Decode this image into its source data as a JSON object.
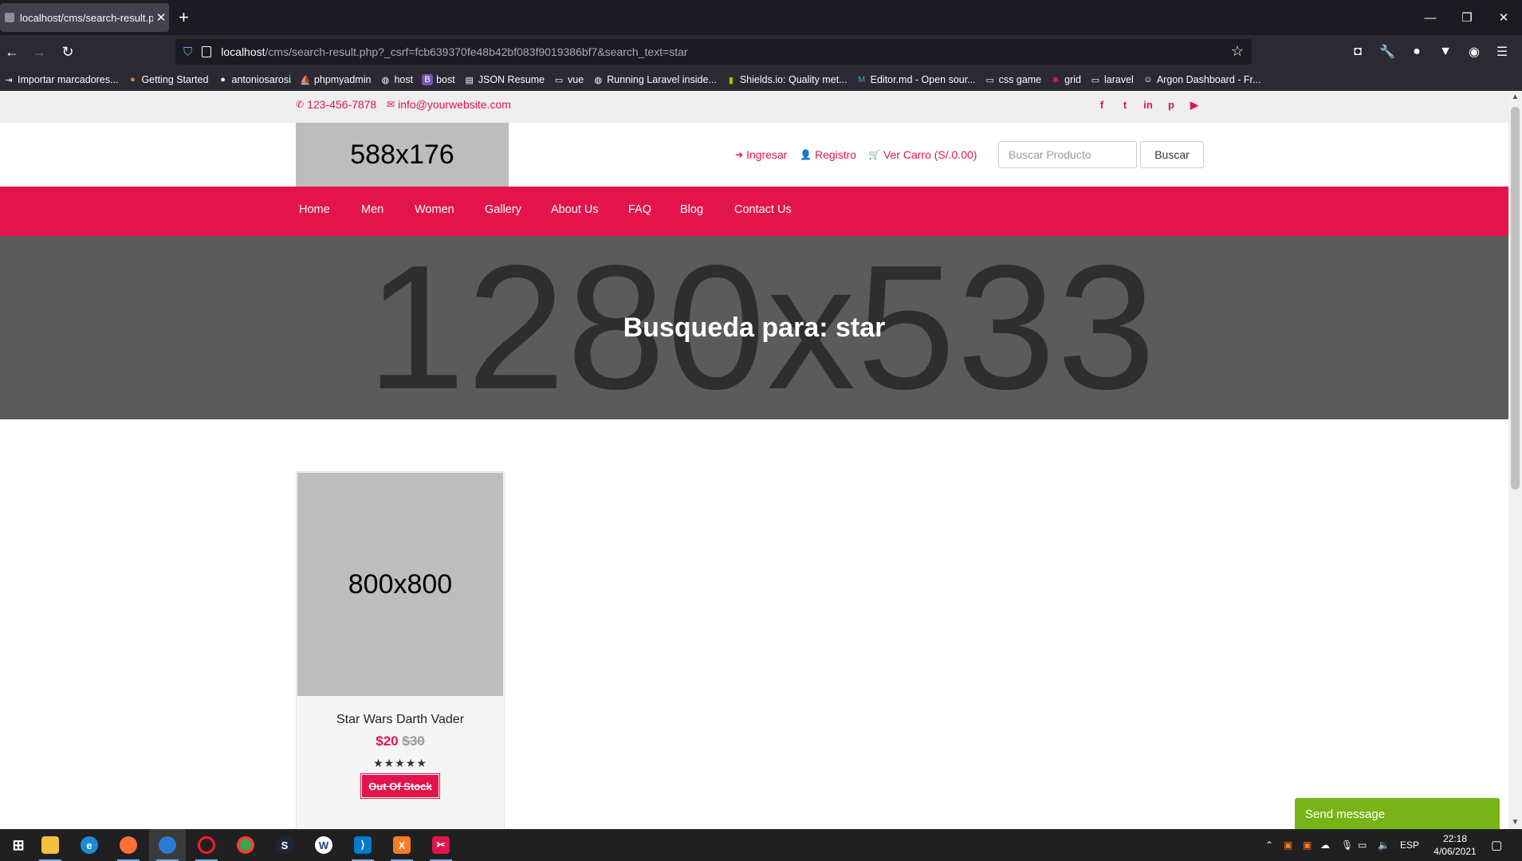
{
  "browser": {
    "tab_title": "localhost/cms/search-result.php",
    "url_host": "localhost",
    "url_rest": "/cms/search-result.php?_csrf=fcb639370fe48b42bf083f9019386bf7&search_text=star",
    "bookmarks": [
      {
        "icon": "import-icon",
        "label": "Importar marcadores..."
      },
      {
        "icon": "firefox-icon",
        "label": "Getting Started"
      },
      {
        "icon": "github-icon",
        "label": "antoniosarosi"
      },
      {
        "icon": "phpmyadmin-icon",
        "label": "phpmyadmin"
      },
      {
        "icon": "globe-icon",
        "label": "host"
      },
      {
        "icon": "bootstrap-icon",
        "label": "bost"
      },
      {
        "icon": "page-icon",
        "label": "JSON Resume"
      },
      {
        "icon": "folder-icon",
        "label": "vue"
      },
      {
        "icon": "globe-icon",
        "label": "Running Laravel inside..."
      },
      {
        "icon": "shields-icon",
        "label": "Shields.io: Quality met..."
      },
      {
        "icon": "editor-icon",
        "label": "Editor.md - Open sour..."
      },
      {
        "icon": "folder-icon",
        "label": "css game"
      },
      {
        "icon": "asterisk-icon",
        "label": "grid"
      },
      {
        "icon": "folder-icon",
        "label": "laravel"
      },
      {
        "icon": "avatar-icon",
        "label": "Argon Dashboard - Fr..."
      }
    ]
  },
  "topbar": {
    "phone": "123-456-7878",
    "email": "info@yourwebsite.com",
    "social": [
      "f",
      "t",
      "in",
      "p",
      "▶"
    ]
  },
  "header": {
    "logo_placeholder": "588x176",
    "login": "Ingresar",
    "register": "Registro",
    "cart": "Ver Carro (S/.0.00)",
    "search_placeholder": "Buscar Producto",
    "search_button": "Buscar"
  },
  "nav": [
    "Home",
    "Men",
    "Women",
    "Gallery",
    "About Us",
    "FAQ",
    "Blog",
    "Contact Us"
  ],
  "banner": {
    "placeholder": "1280x533",
    "title": "Busqueda para: star"
  },
  "product": {
    "image_placeholder": "800x800",
    "name": "Star Wars Darth Vader",
    "price": "$20",
    "old_price": "$30",
    "rating": 5,
    "stars": "★★★★★",
    "stock": "Out Of Stock"
  },
  "chat": {
    "label": "Send message"
  },
  "taskbar": {
    "language": "ESP",
    "time": "22:18",
    "date": "4/06/2021",
    "notifications": "1"
  },
  "colors": {
    "accent": "#e3144c",
    "chat": "#78b417"
  }
}
